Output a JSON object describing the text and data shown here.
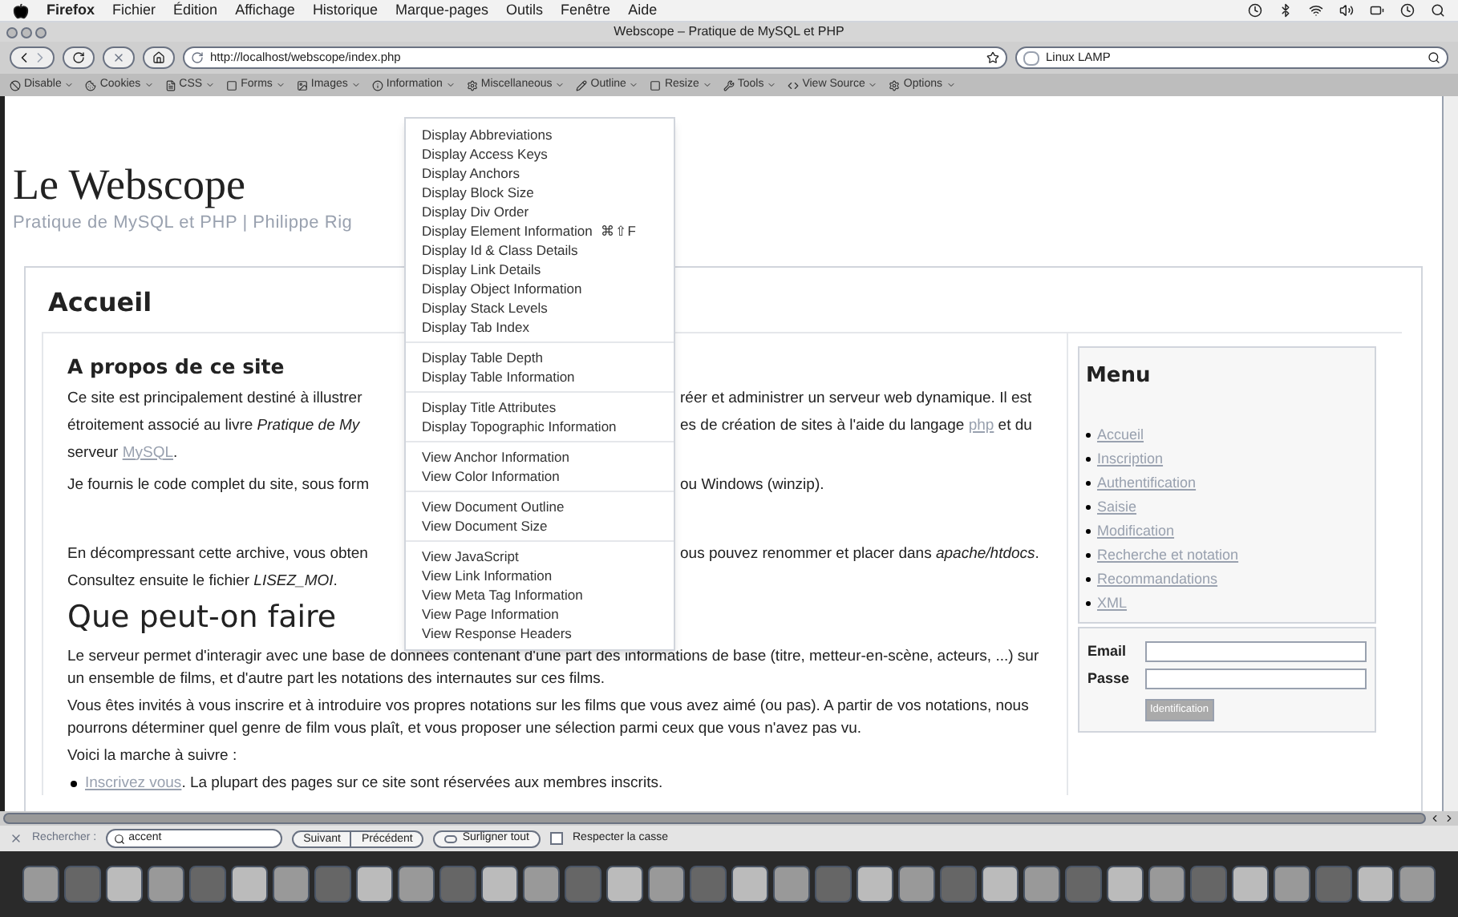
{
  "os_menubar": {
    "app": "Firefox",
    "items": [
      "Fichier",
      "Édition",
      "Affichage",
      "Historique",
      "Marque-pages",
      "Outils",
      "Fenêtre",
      "Aide"
    ]
  },
  "window": {
    "title": "Webscope – Pratique de MySQL et PHP"
  },
  "navbar": {
    "url": "http://localhost/webscope/index.php",
    "search": "Linux LAMP"
  },
  "dev_toolbar": {
    "items": [
      "Disable",
      "Cookies",
      "CSS",
      "Forms",
      "Images",
      "Information",
      "Miscellaneous",
      "Outline",
      "Resize",
      "Tools",
      "View Source",
      "Options"
    ]
  },
  "page": {
    "site_title": "Le Webscope",
    "site_subtitle": "Pratique de MySQL et PHP | Philippe Rig",
    "section_title": "Accueil",
    "about": {
      "heading": "A propos de ce site",
      "paragraphs": [
        [
          {
            "left": [
              {
                "text": "Ce site est principalement destiné à illustrer",
                "kind": "plain"
              }
            ],
            "right": [
              {
                "text": "réer et administrer un serveur web dynamique. Il est",
                "kind": "plain"
              }
            ]
          },
          {
            "left": [
              {
                "text": "étroitement associé au livre ",
                "kind": "plain"
              },
              {
                "text": "Pratique de My",
                "kind": "italic"
              }
            ],
            "right": [
              {
                "text": "es de création de sites à l'aide du langage ",
                "kind": "plain"
              },
              {
                "text": "php",
                "kind": "link"
              },
              {
                "text": " et du",
                "kind": "plain"
              }
            ]
          },
          {
            "full": [
              {
                "text": "serveur ",
                "kind": "plain"
              },
              {
                "text": "MySQL",
                "kind": "link"
              },
              {
                "text": ".",
                "kind": "plain"
              }
            ]
          }
        ],
        [
          {
            "left": [
              {
                "text": "Je fournis le code complet du site, sous form",
                "kind": "plain"
              }
            ],
            "right": [
              {
                "text": "ou Windows (winzip).",
                "kind": "plain"
              }
            ]
          }
        ],
        [
          {
            "left": [
              {
                "text": "En décompressant cette archive, vous obten",
                "kind": "plain"
              }
            ],
            "right": [
              {
                "text": "ous pouvez renommer et placer dans ",
                "kind": "plain"
              },
              {
                "text": "apache/htdocs",
                "kind": "italic"
              },
              {
                "text": ".",
                "kind": "plain"
              }
            ]
          },
          {
            "full": [
              {
                "text": "Consultez ensuite le fichier ",
                "kind": "plain"
              },
              {
                "text": "LISEZ_MOI",
                "kind": "italic"
              },
              {
                "text": ".",
                "kind": "plain"
              }
            ]
          }
        ]
      ]
    },
    "features": {
      "heading": "Que peut-on faire",
      "paragraphs": [
        "Le serveur permet d'interagir avec une base de données contenant d'une part des informations de base (titre, metteur-en-scène, acteurs, ...) sur un ensemble de films, et d'autre part les notations des internautes sur ces films.",
        "Vous êtes invités à vous inscrire et à introduire vos propres notations sur les films que vous avez aimé (ou pas). A partir de vos notations, nous pourrons déterminer quel genre de film vous plaît, et vous proposer une sélection parmi ceux que vous n'avez pas vu.",
        "Voici la marche à suivre :"
      ],
      "steps": [
        {
          "link": "Inscrivez vous",
          "text": ". La plupart des pages sur ce site sont réservées aux membres inscrits."
        }
      ]
    }
  },
  "sidebar": {
    "title": "Menu",
    "links": [
      "Accueil",
      "Inscription",
      "Authentification",
      "Saisie",
      "Modification",
      "Recherche et notation",
      "Recommandations",
      "XML"
    ],
    "login": {
      "email_label": "Email",
      "password_label": "Passe",
      "button": "Identification"
    }
  },
  "info_menu": {
    "groups": [
      [
        {
          "label": "Display Abbreviations"
        },
        {
          "label": "Display Access Keys"
        },
        {
          "label": "Display Anchors"
        },
        {
          "label": "Display Block Size"
        },
        {
          "label": "Display Div Order"
        },
        {
          "label": "Display Element Information",
          "shortcut": "⌘⇧F"
        },
        {
          "label": "Display Id & Class Details"
        },
        {
          "label": "Display Link Details"
        },
        {
          "label": "Display Object Information"
        },
        {
          "label": "Display Stack Levels"
        },
        {
          "label": "Display Tab Index"
        }
      ],
      [
        {
          "label": "Display Table Depth"
        },
        {
          "label": "Display Table Information"
        }
      ],
      [
        {
          "label": "Display Title Attributes"
        },
        {
          "label": "Display Topographic Information"
        }
      ],
      [
        {
          "label": "View Anchor Information"
        },
        {
          "label": "View Color Information"
        }
      ],
      [
        {
          "label": "View Document Outline"
        },
        {
          "label": "View Document Size"
        }
      ],
      [
        {
          "label": "View JavaScript"
        },
        {
          "label": "View Link Information"
        },
        {
          "label": "View Meta Tag Information"
        },
        {
          "label": "View Page Information"
        },
        {
          "label": "View Response Headers"
        }
      ]
    ]
  },
  "find_bar": {
    "label": "Rechercher :",
    "value": "accent",
    "next": "Suivant",
    "previous": "Précédent",
    "highlight": "Surligner tout",
    "match_case": {
      "label": "Respecter la casse",
      "checked": false
    }
  }
}
